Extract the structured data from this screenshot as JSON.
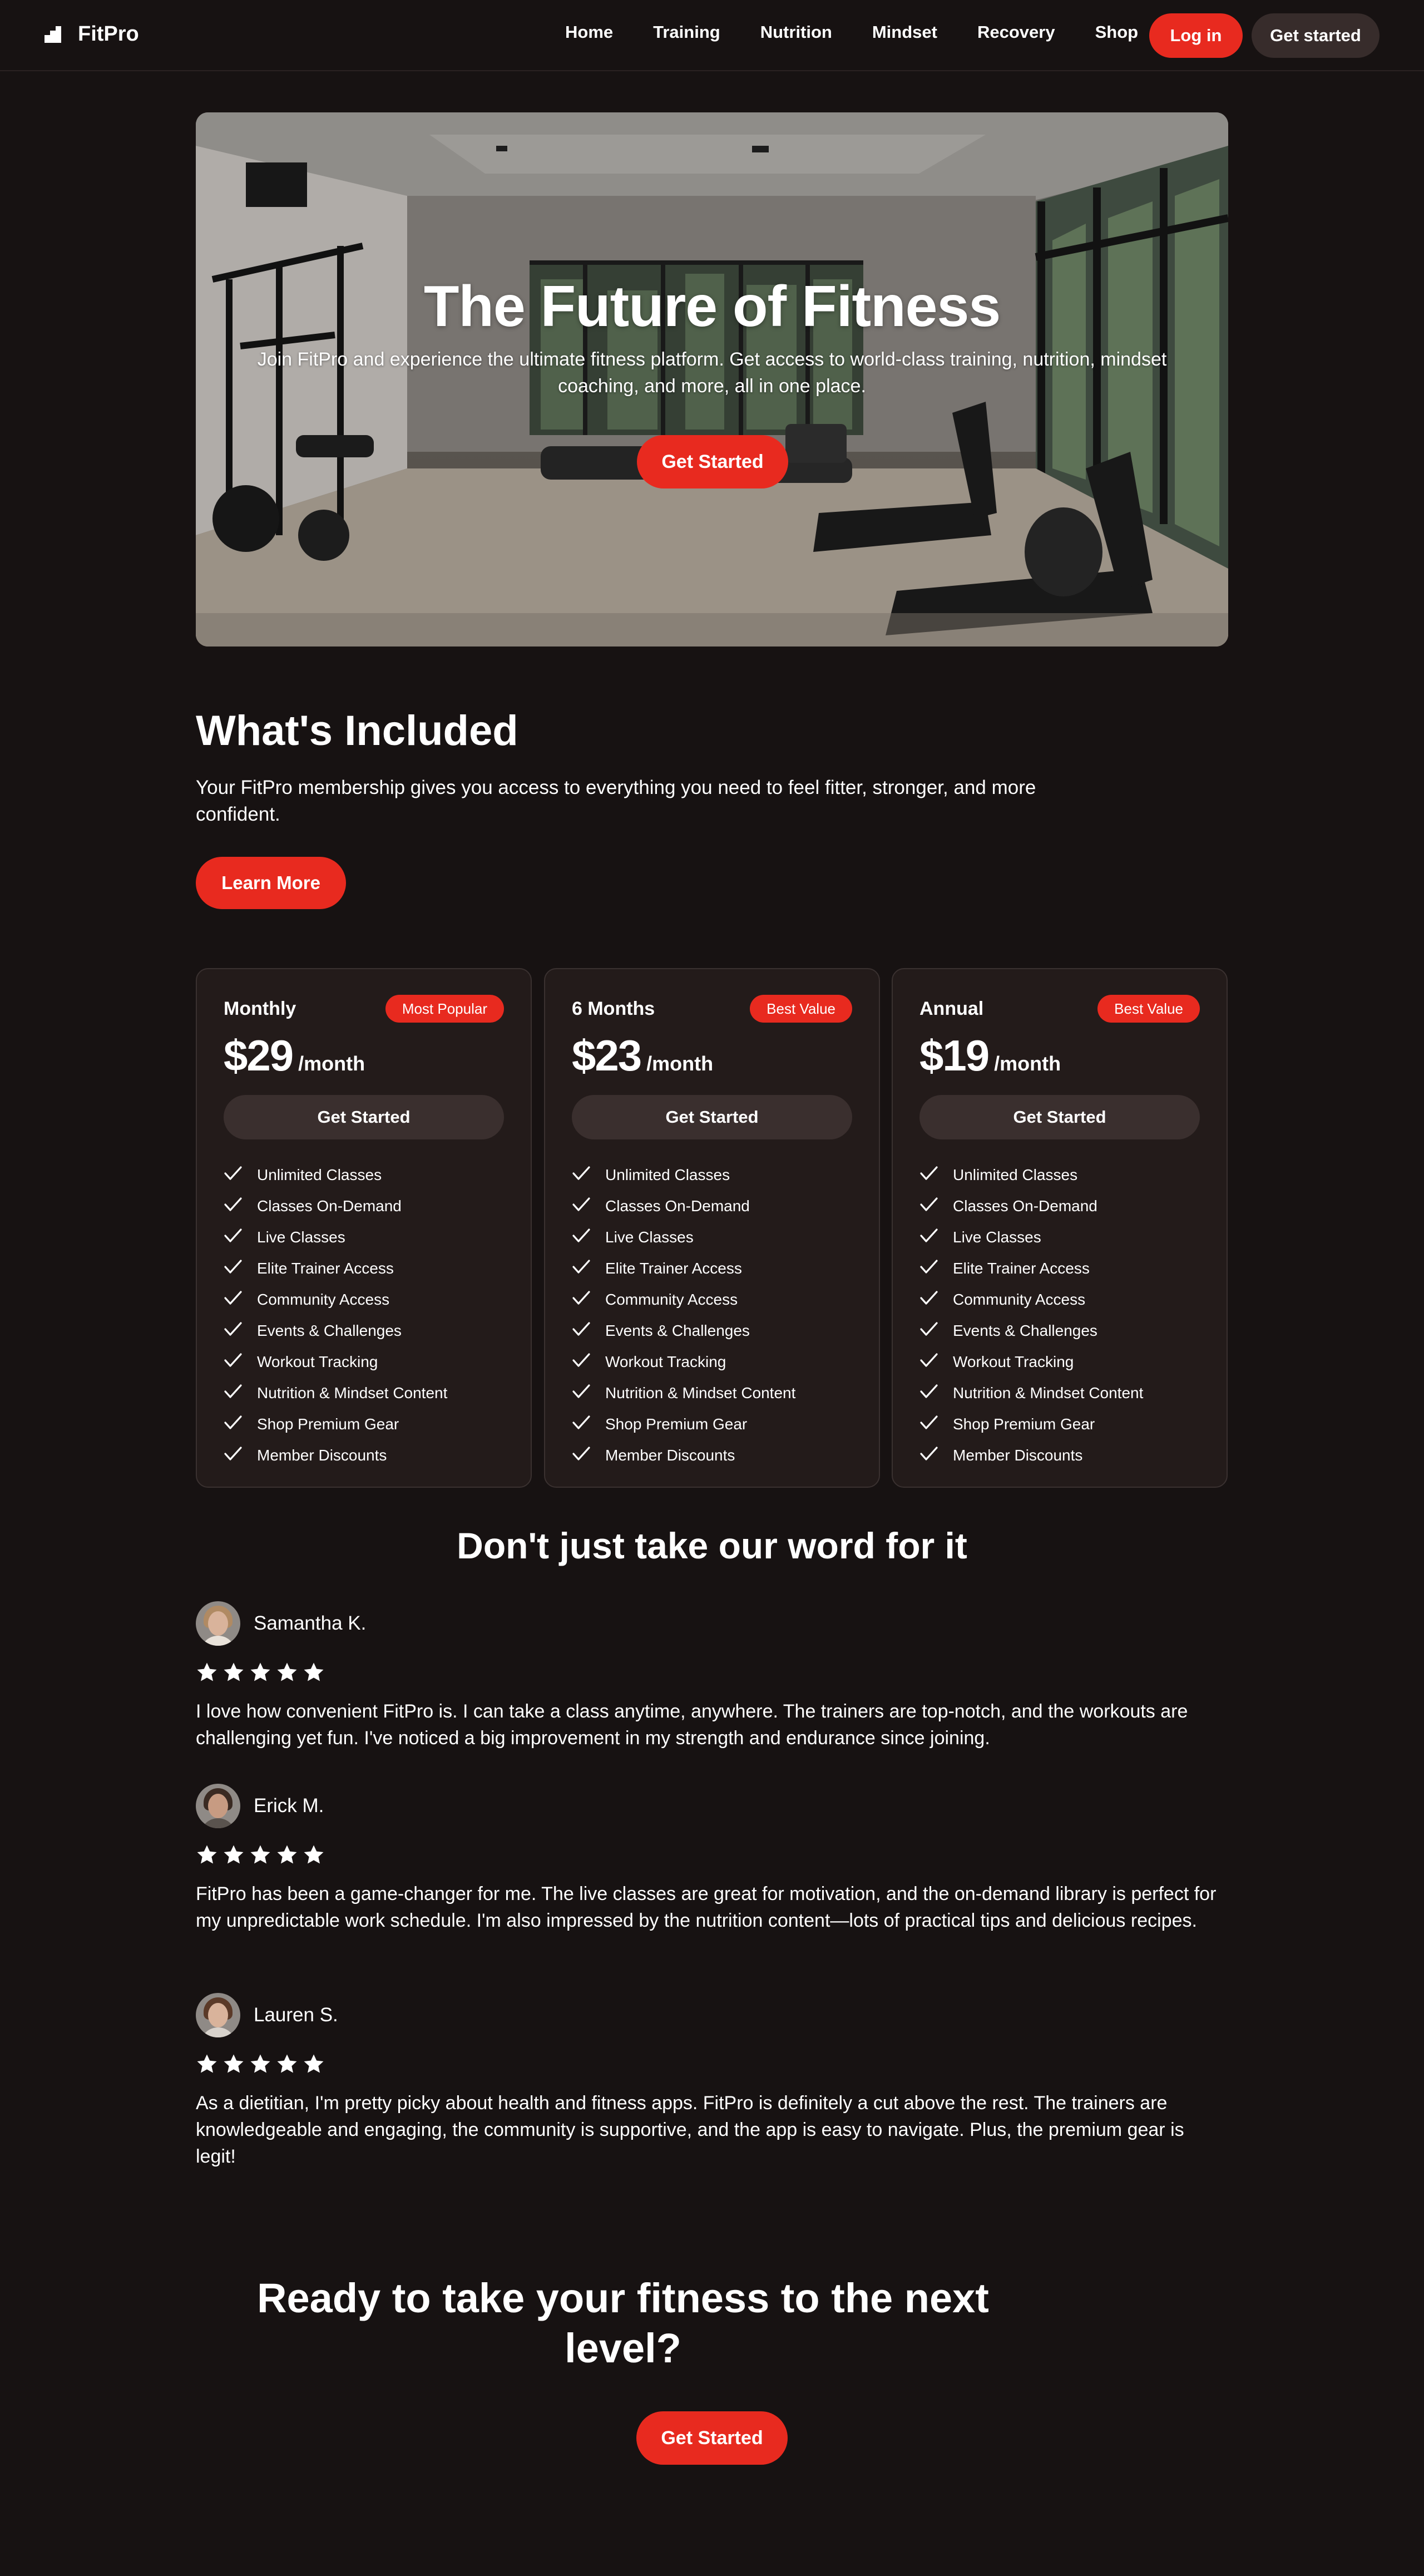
{
  "brand": {
    "name": "FitPro",
    "icon": "bar-chart-icon"
  },
  "nav": {
    "items": [
      "Home",
      "Training",
      "Nutrition",
      "Mindset",
      "Recovery",
      "Shop"
    ],
    "login_label": "Log in",
    "get_started_label": "Get started"
  },
  "hero": {
    "title": "The Future of Fitness",
    "subtitle": "Join FitPro and experience the ultimate fitness platform. Get access to world-class training, nutrition, mindset coaching, and more, all in one place.",
    "button_label": "Get Started",
    "background": "gym-interior-photo"
  },
  "included": {
    "title": "What's Included",
    "description": "Your FitPro membership gives you access to everything you need to feel fitter, stronger, and more confident.",
    "button_label": "Learn More"
  },
  "plans": [
    {
      "name": "Monthly",
      "badge": "Most Popular",
      "price": "$29",
      "unit": "/month",
      "button_label": "Get Started",
      "features": [
        "Unlimited Classes",
        "Classes On-Demand",
        "Live Classes",
        "Elite Trainer Access",
        "Community Access",
        "Events & Challenges",
        "Workout Tracking",
        "Nutrition & Mindset Content",
        "Shop Premium Gear",
        "Member Discounts"
      ]
    },
    {
      "name": "6 Months",
      "badge": "Best Value",
      "price": "$23",
      "unit": "/month",
      "button_label": "Get Started",
      "features": [
        "Unlimited Classes",
        "Classes On-Demand",
        "Live Classes",
        "Elite Trainer Access",
        "Community Access",
        "Events & Challenges",
        "Workout Tracking",
        "Nutrition & Mindset Content",
        "Shop Premium Gear",
        "Member Discounts"
      ]
    },
    {
      "name": "Annual",
      "badge": "Best Value",
      "price": "$19",
      "unit": "/month",
      "button_label": "Get Started",
      "features": [
        "Unlimited Classes",
        "Classes On-Demand",
        "Live Classes",
        "Elite Trainer Access",
        "Community Access",
        "Events & Challenges",
        "Workout Tracking",
        "Nutrition & Mindset Content",
        "Shop Premium Gear",
        "Member Discounts"
      ]
    }
  ],
  "testimonials": {
    "heading": "Don't just take our word for it",
    "reviews": [
      {
        "name": "Samantha K.",
        "rating": 5,
        "text": "I love how convenient FitPro is. I can take a class anytime, anywhere. The trainers are top-notch, and the workouts are challenging yet fun. I've noticed a big improvement in my strength and endurance since joining."
      },
      {
        "name": "Erick M.",
        "rating": 5,
        "text": "FitPro has been a game-changer for me. The live classes are great for motivation, and the on-demand library is perfect for my unpredictable work schedule. I'm also impressed by the nutrition content—lots of practical tips and delicious recipes."
      },
      {
        "name": "Lauren S.",
        "rating": 5,
        "text": "As a dietitian, I'm pretty picky about health and fitness apps. FitPro is definitely a cut above the rest. The trainers are knowledgeable and engaging, the community is supportive, and the app is easy to navigate. Plus, the premium gear is legit!"
      }
    ]
  },
  "cta": {
    "title": "Ready to take your fitness to the next level?",
    "button_label": "Get Started"
  },
  "colors": {
    "background": "#171212",
    "accent": "#e82a1f",
    "card": "#231b1a",
    "secondary_button": "#372c2b"
  }
}
